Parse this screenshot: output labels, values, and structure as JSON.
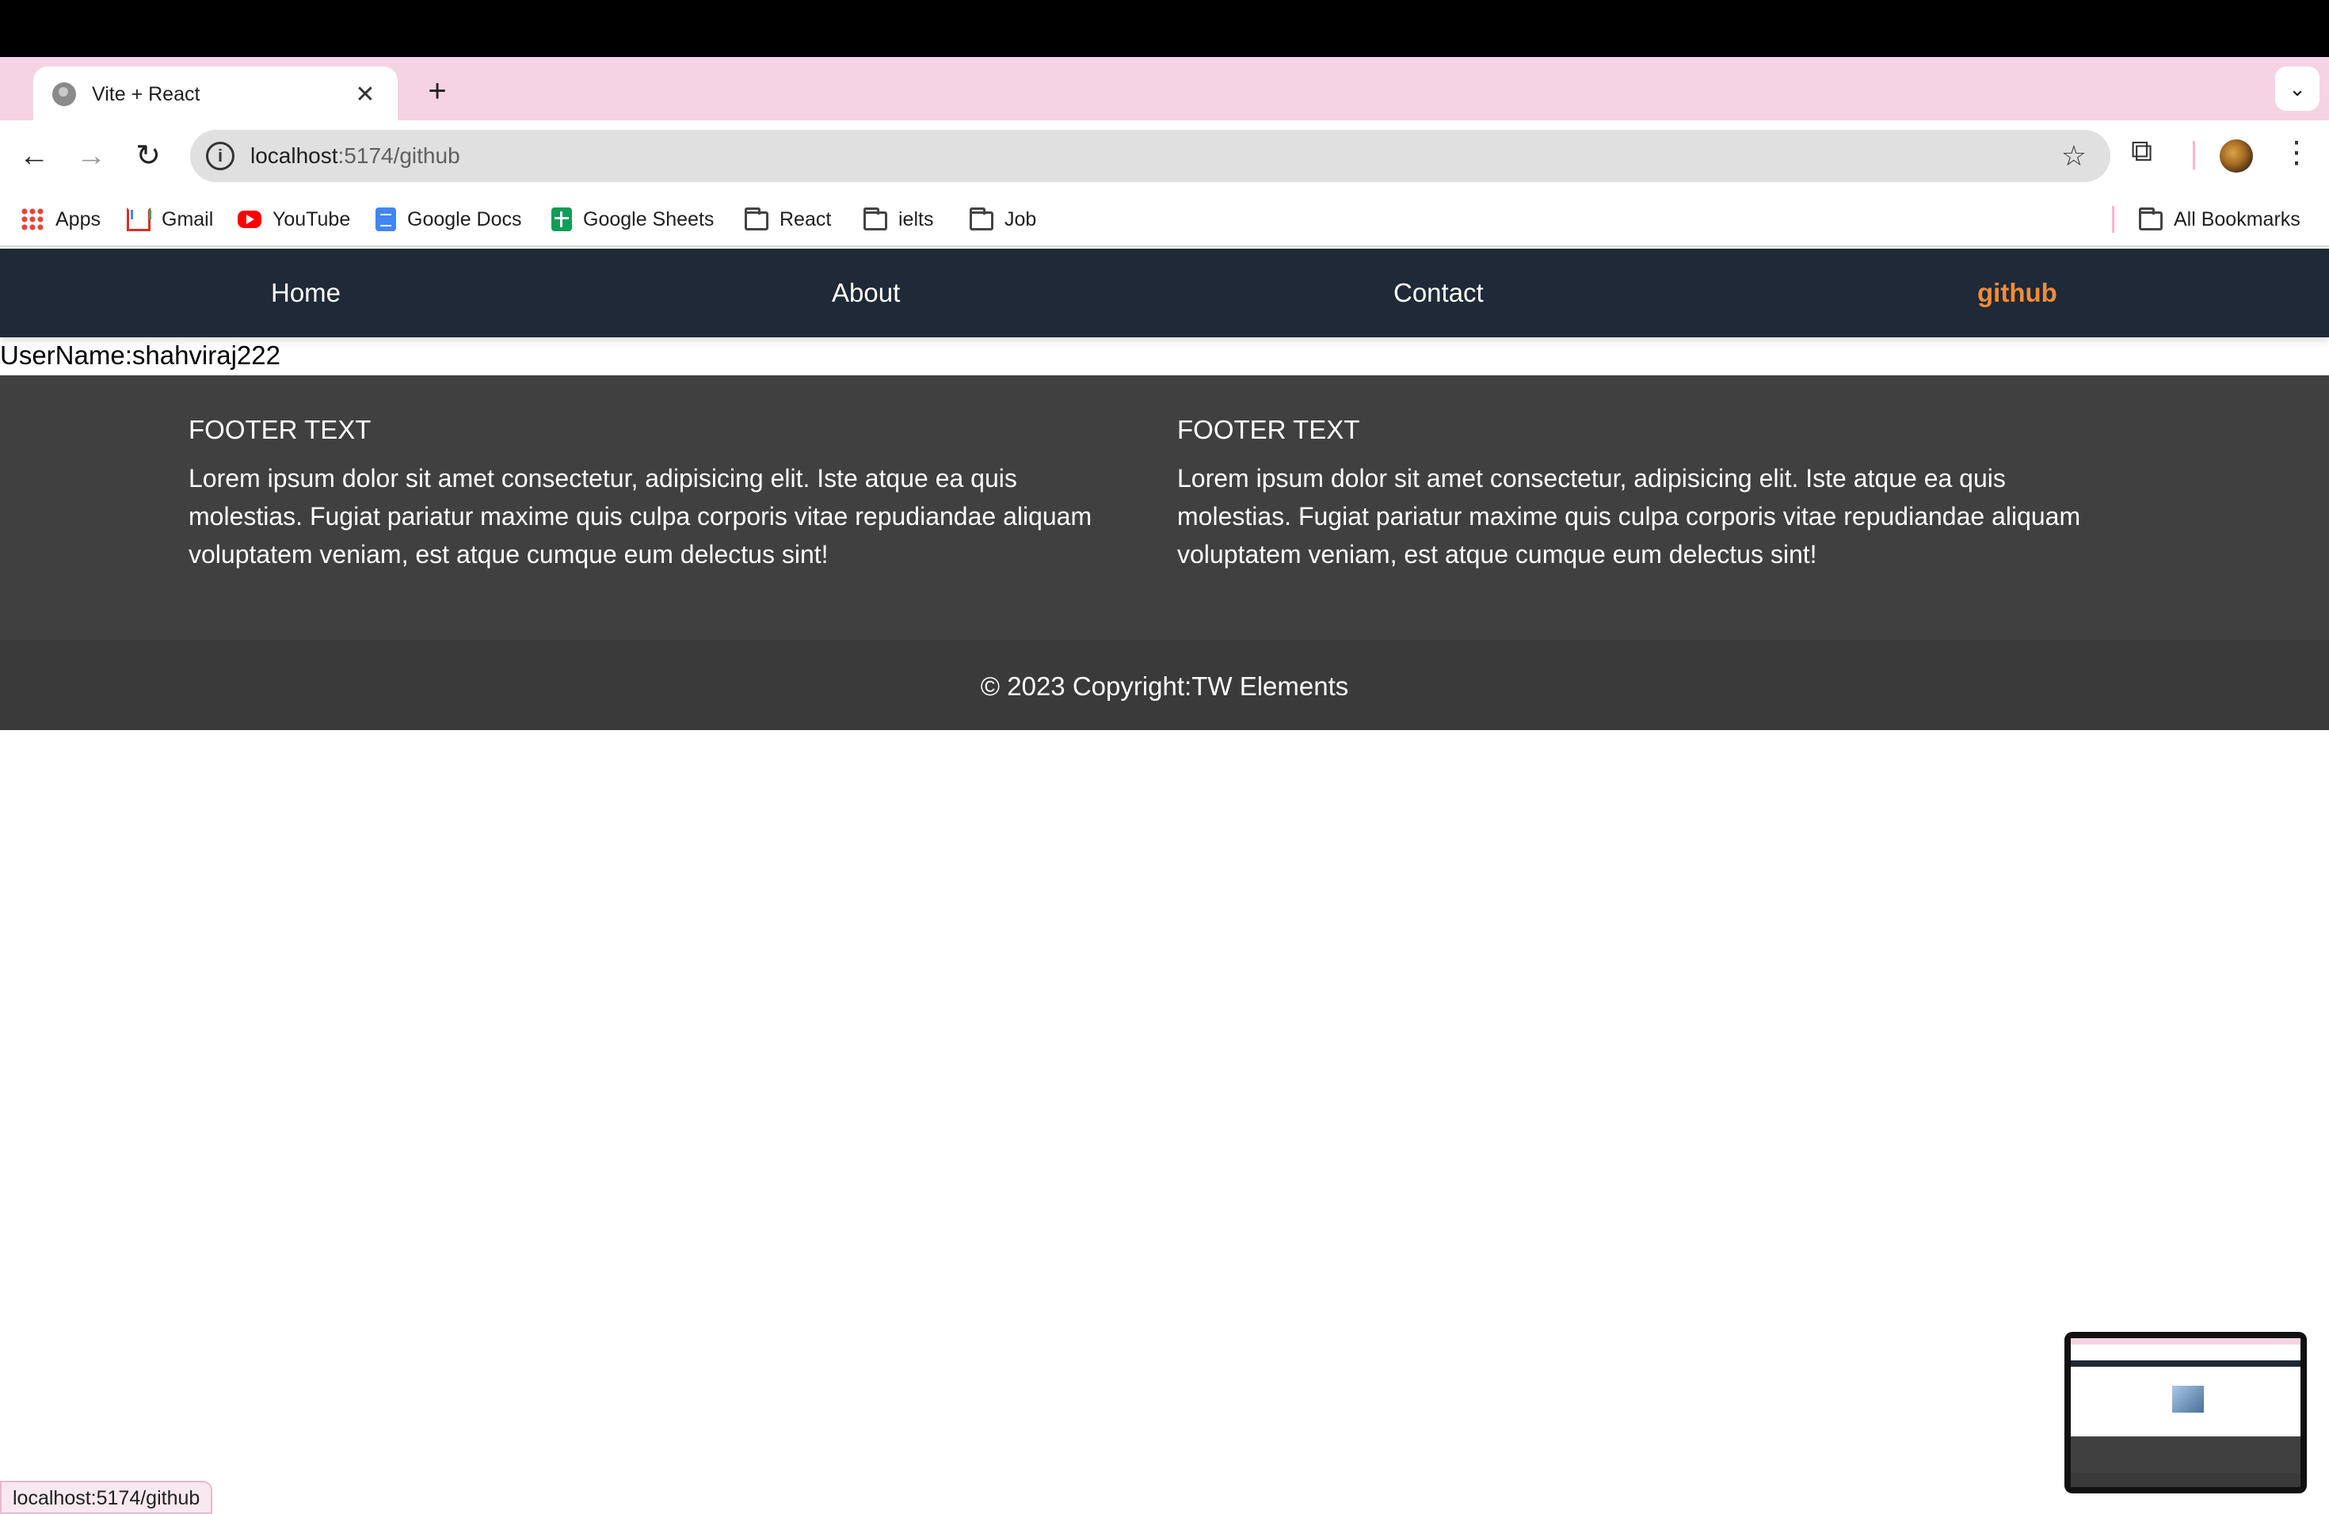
{
  "browser": {
    "tab_title": "Vite + React",
    "close_glyph": "✕",
    "new_tab_glyph": "+",
    "dropdown_glyph": "⌄",
    "url_host": "localhost",
    "url_path": ":5174/github",
    "status_url": "localhost:5174/github",
    "back_glyph": "←",
    "forward_glyph": "→",
    "reload_glyph": "↻",
    "info_glyph": "i",
    "star_glyph": "☆",
    "extensions_glyph": "⧉",
    "menu_glyph": "⋮"
  },
  "bookmarks": {
    "items": [
      {
        "label": "Apps",
        "icon": "apps-grid-icon"
      },
      {
        "label": "Gmail",
        "icon": "gmail-icon"
      },
      {
        "label": "YouTube",
        "icon": "youtube-icon"
      },
      {
        "label": "Google Docs",
        "icon": "google-docs-icon"
      },
      {
        "label": "Google Sheets",
        "icon": "google-sheets-icon"
      },
      {
        "label": "React",
        "icon": "folder-icon"
      },
      {
        "label": "ielts",
        "icon": "folder-icon"
      },
      {
        "label": "Job",
        "icon": "folder-icon"
      }
    ],
    "all_bookmarks": "All Bookmarks"
  },
  "nav": {
    "links": [
      {
        "label": "Home",
        "active": false
      },
      {
        "label": "About",
        "active": false
      },
      {
        "label": "Contact",
        "active": false
      },
      {
        "label": "github",
        "active": true
      }
    ],
    "active_color": "#f28c38",
    "bg_color": "#1f2937"
  },
  "main": {
    "username_text": "UserName:shahviraj222"
  },
  "footer": {
    "columns": [
      {
        "heading": "FOOTER TEXT",
        "body": "Lorem ipsum dolor sit amet consectetur, adipisicing elit. Iste atque ea quis molestias. Fugiat pariatur maxime quis culpa corporis vitae repudiandae aliquam voluptatem veniam, est atque cumque eum delectus sint!"
      },
      {
        "heading": "FOOTER TEXT",
        "body": "Lorem ipsum dolor sit amet consectetur, adipisicing elit. Iste atque ea quis molestias. Fugiat pariatur maxime quis culpa corporis vitae repudiandae aliquam voluptatem veniam, est atque cumque eum delectus sint!"
      }
    ],
    "copyright": "© 2023 Copyright:TW Elements",
    "bg_color": "#404040"
  }
}
